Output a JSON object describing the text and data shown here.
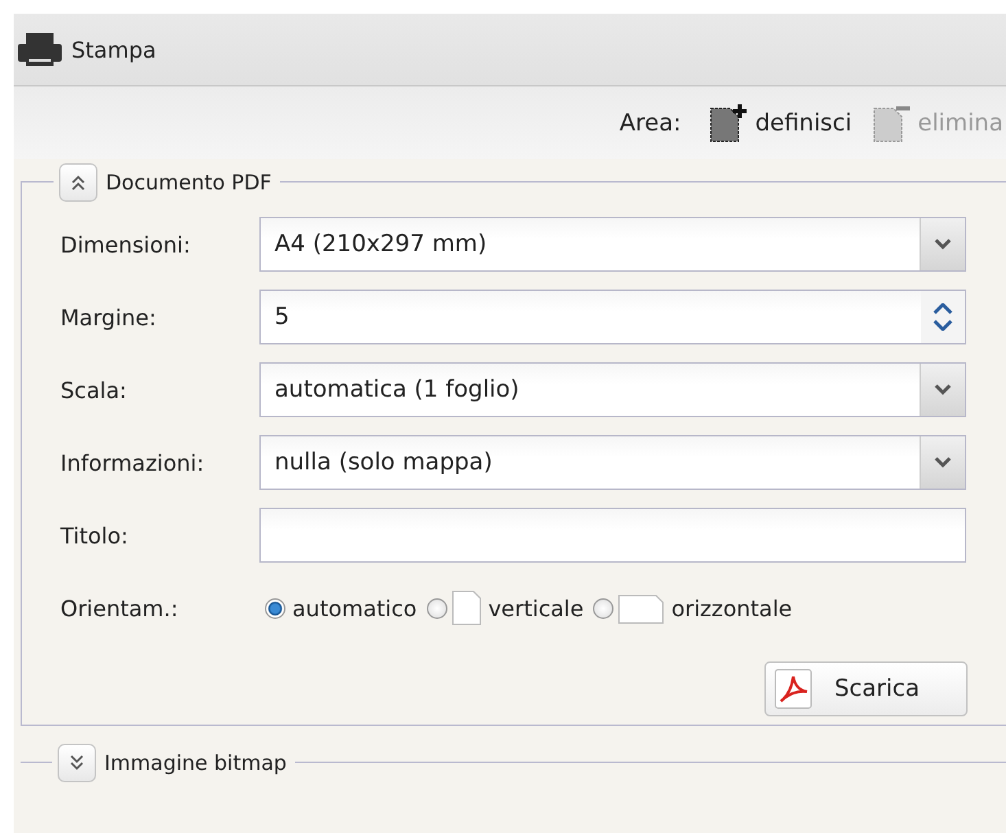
{
  "panel": {
    "title": "Stampa"
  },
  "toolbar": {
    "label": "Area:",
    "actions": [
      {
        "label": "definisci",
        "disabled": false,
        "kind": "add"
      },
      {
        "label": "elimina",
        "disabled": true,
        "kind": "remove"
      }
    ]
  },
  "sections": [
    {
      "title": "Documento PDF",
      "expanded": true,
      "fields": [
        {
          "label": "Dimensioni:",
          "kind": "select",
          "value": "A4 (210x297 mm)"
        },
        {
          "label": "Margine:",
          "kind": "spinner",
          "value": "5"
        },
        {
          "label": "Scala:",
          "kind": "select",
          "value": "automatica (1 foglio)"
        },
        {
          "label": "Informazioni:",
          "kind": "select",
          "value": "nulla (solo mappa)"
        },
        {
          "label": "Titolo:",
          "kind": "text"
        },
        {
          "label": "Orientam.:",
          "kind": "radio",
          "options": [
            {
              "label": "automatico",
              "selected": true,
              "kind": "plain"
            },
            {
              "label": "verticale",
              "selected": false,
              "kind": "portrait"
            },
            {
              "label": "orizzontale",
              "selected": false,
              "kind": "landscape"
            }
          ]
        }
      ],
      "button": "Scarica"
    },
    {
      "title": "Immagine bitmap",
      "expanded": false
    }
  ]
}
